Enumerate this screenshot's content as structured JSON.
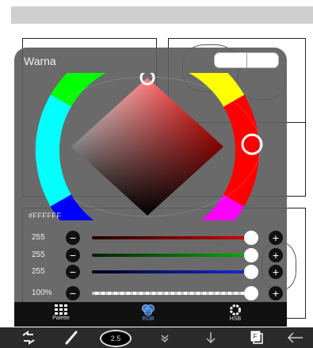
{
  "dialog": {
    "title": "Warna",
    "hex": "#FFFFFF",
    "selected_color": "#ffffff"
  },
  "sliders": [
    {
      "label": "255",
      "channel": "red",
      "color": "#d40000"
    },
    {
      "label": "255",
      "channel": "green",
      "color": "#00b000"
    },
    {
      "label": "255",
      "channel": "blue",
      "color": "#1a2bd6"
    },
    {
      "label": "100%",
      "channel": "opacity",
      "color": "#ffffff"
    }
  ],
  "tabs": [
    {
      "label": "Palette",
      "icon": "palette-grid-icon"
    },
    {
      "label": "RGB",
      "icon": "rgb-circles-icon",
      "active": true
    },
    {
      "label": "HSB",
      "icon": "hsb-ring-icon"
    }
  ],
  "toolbar": {
    "brush_size": "2.5",
    "items": [
      "transform-icon",
      "brush-icon",
      "brush-size-indicator",
      "chevron-down-icon",
      "arrow-down-icon",
      "layers-icon",
      "back-arrow-icon"
    ]
  }
}
